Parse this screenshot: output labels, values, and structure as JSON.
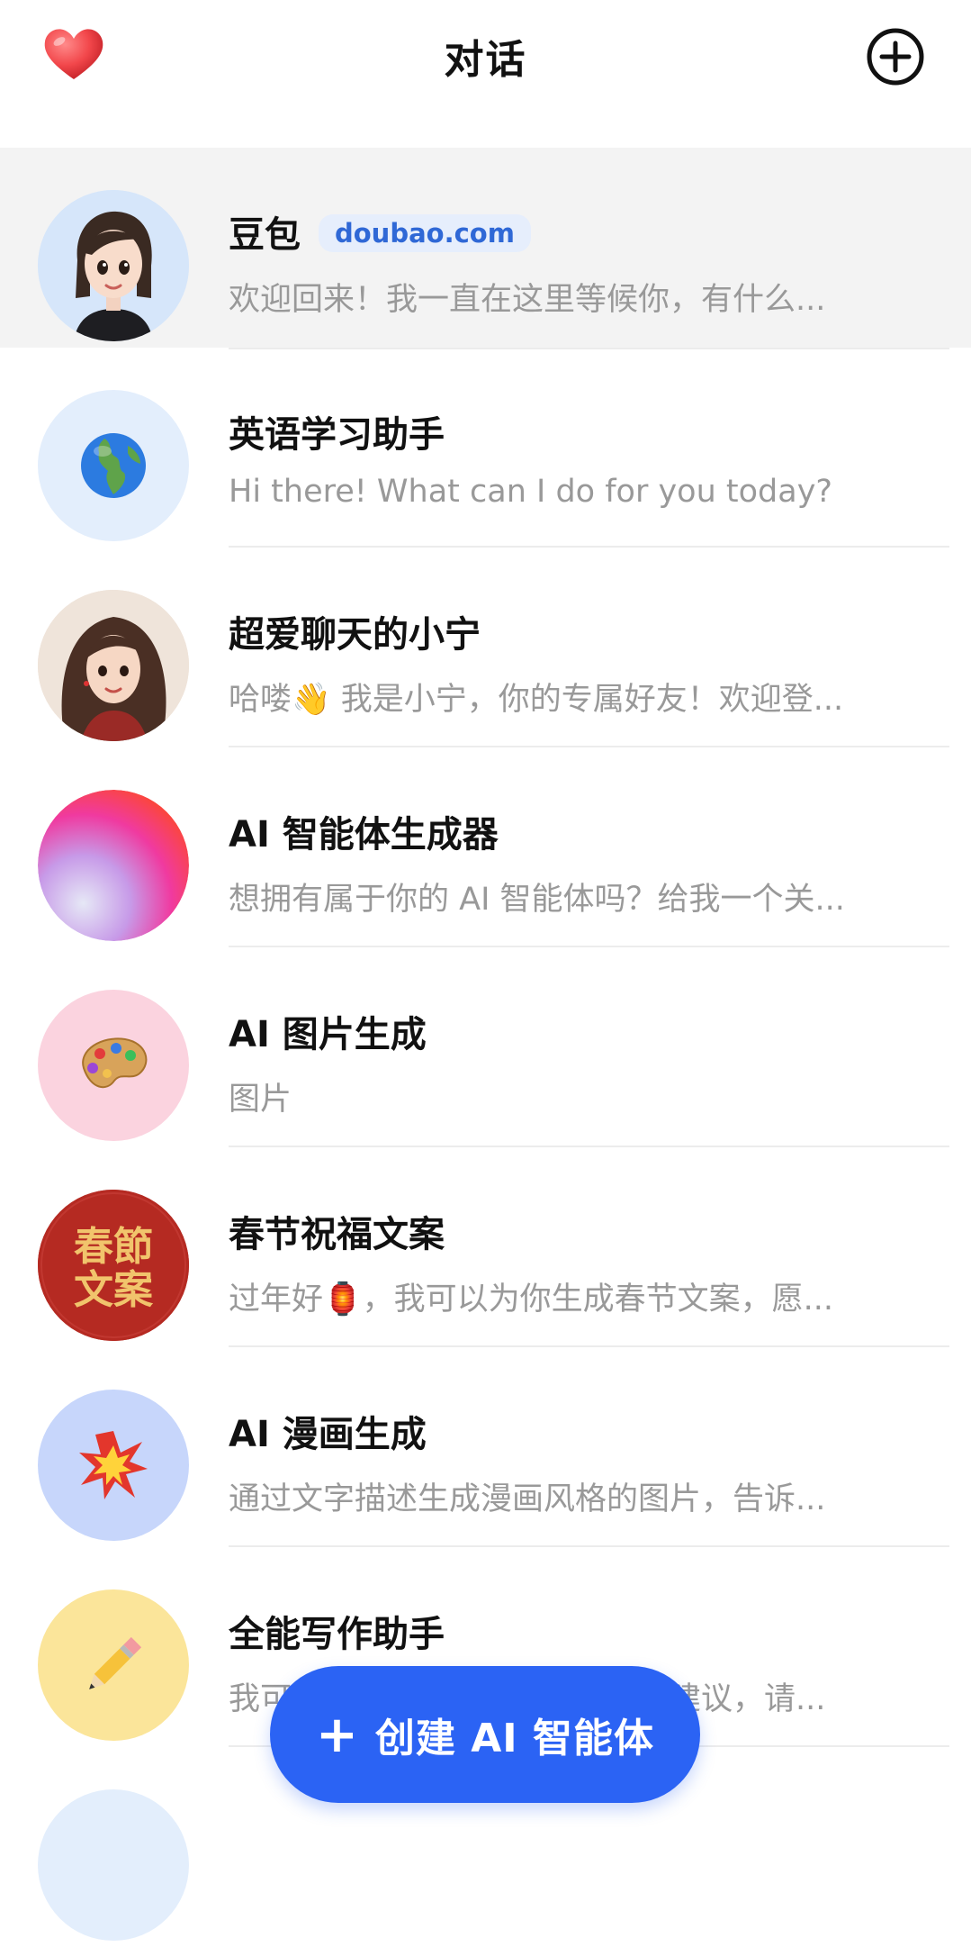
{
  "header": {
    "title": "对话"
  },
  "conversations": [
    {
      "name": "豆包",
      "badge": "doubao.com",
      "preview": "欢迎回来！我一直在这里等候你，有什么...",
      "avatar": "girl-avatar-icon",
      "selected": true
    },
    {
      "name": "英语学习助手",
      "preview": "Hi there! What can I do for you today?",
      "avatar": "globe-icon"
    },
    {
      "name": "超爱聊天的小宁",
      "preview": "哈喽👋 我是小宁，你的专属好友！欢迎登...",
      "avatar": "long-hair-girl-avatar-icon"
    },
    {
      "name": "AI 智能体生成器",
      "preview": "想拥有属于你的 AI 智能体吗？给我一个关...",
      "avatar": "gradient-orb-icon"
    },
    {
      "name": "AI 图片生成",
      "preview": "图片",
      "avatar": "palette-icon"
    },
    {
      "name": "春节祝福文案",
      "preview": "过年好🏮，我可以为你生成春节文案，愿...",
      "avatar": "spring-festival-icon",
      "avatar_text": [
        "春節",
        "文案"
      ]
    },
    {
      "name": "AI 漫画生成",
      "preview": "通过文字描述生成漫画风格的图片，告诉...",
      "avatar": "explosion-icon"
    },
    {
      "name": "全能写作助手",
      "preview": "我可以为你提供写作灵感和文案建议，请...",
      "avatar": "pencil-icon"
    }
  ],
  "fab": {
    "label": "创建 AI 智能体"
  },
  "colors": {
    "accent": "#2b63f4",
    "badge_text": "#2f68d6",
    "badge_bg": "#e6eefc",
    "selected_row": "#f3f3f3",
    "preview_text": "#999999"
  }
}
